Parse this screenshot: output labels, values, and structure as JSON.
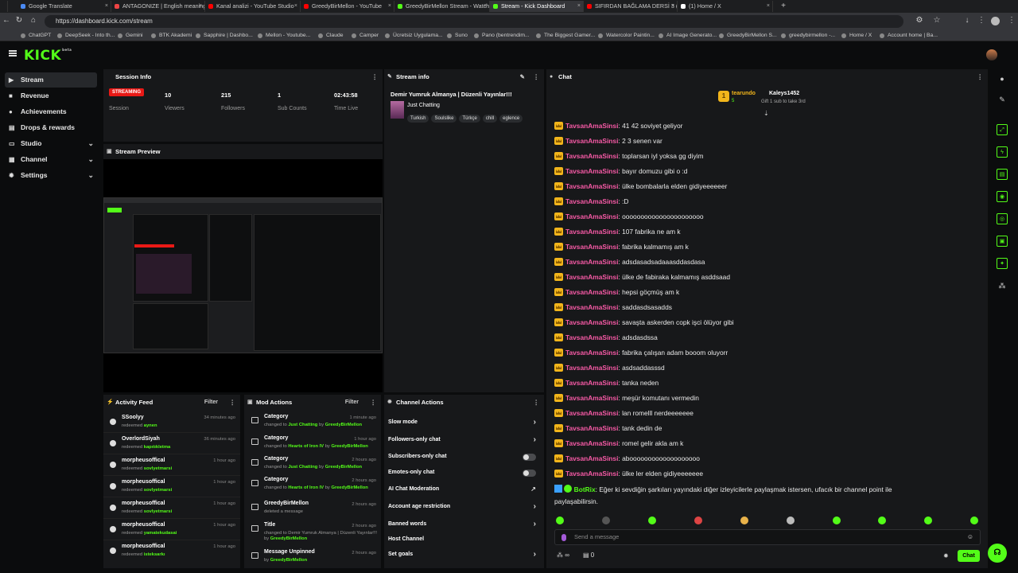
{
  "browser": {
    "tabs": [
      {
        "title": "Google Translate",
        "color": "#4a8af4"
      },
      {
        "title": "ANTAGONIZE | English meaning -",
        "color": "#e44"
      },
      {
        "title": "Kanal analizi - YouTube Studio",
        "color": "#f00"
      },
      {
        "title": "GreedyBirMellon - YouTube",
        "color": "#f00"
      },
      {
        "title": "GreedyBirMellon Stream - Watch L",
        "color": "#53fc18"
      },
      {
        "title": "Stream - Kick Dashboard",
        "color": "#53fc18"
      },
      {
        "title": "SIFIRDAN BAĞLAMA DERSİ 3 (EN",
        "color": "#f00"
      },
      {
        "title": "(1) Home / X",
        "color": "#fff"
      }
    ],
    "new_tab_label": "+",
    "url": "https://dashboard.kick.com/stream",
    "bookmarks": [
      "ChatGPT",
      "DeepSeek - Into th...",
      "Gemini",
      "BTK Akademi",
      "Sapphire | Dashbo...",
      "Mellon - Youtube...",
      "Claude",
      "Camper",
      "Ücretsiz Uygulama...",
      "Suno",
      "Pano (bentrendim...",
      "The Biggest Gamer...",
      "Watercolor Paintin...",
      "AI Image Generato...",
      "GreedyBirMellon S...",
      "greedybirmellon -...",
      "Home / X",
      "Account home | Ba..."
    ]
  },
  "header": {
    "logo": "KICK",
    "logo_sup": "beta"
  },
  "sidebar": {
    "items": [
      {
        "label": "Stream",
        "icon": "▶",
        "chev": ""
      },
      {
        "label": "Revenue",
        "icon": "■",
        "chev": ""
      },
      {
        "label": "Achievements",
        "icon": "●",
        "chev": ""
      },
      {
        "label": "Drops & rewards",
        "icon": "▤",
        "chev": ""
      },
      {
        "label": "Studio",
        "icon": "▭",
        "chev": "⌄"
      },
      {
        "label": "Channel",
        "icon": "▦",
        "chev": "⌄"
      },
      {
        "label": "Settings",
        "icon": "✹",
        "chev": "⌄"
      }
    ]
  },
  "session": {
    "title": "Session Info",
    "status": "STREAMING",
    "status_label": "Session",
    "stats": [
      {
        "value": "10",
        "label": "Viewers"
      },
      {
        "value": "215",
        "label": "Followers"
      },
      {
        "value": "1",
        "label": "Sub Counts"
      },
      {
        "value": "02:43:58",
        "label": "Time Live"
      }
    ]
  },
  "stream_info": {
    "title": "Stream info",
    "stream_title": "Demir Yumruk Almanya | Düzenli Yayınlar!!!",
    "category": "Just Chatting",
    "tags": [
      "Turkish",
      "Soulslike",
      "Türkçe",
      "chill",
      "eglence"
    ]
  },
  "preview": {
    "title": "Stream Preview"
  },
  "activity": {
    "title": "Activity Feed",
    "filter": "Filter",
    "items": [
      {
        "name": "SSoolyy",
        "action": "redeemed",
        "reward": "aynen",
        "time": "34 minutes ago"
      },
      {
        "name": "OverlordSiyah",
        "action": "redeemed",
        "reward": "kapıtıkletma",
        "time": "36 minutes ago"
      },
      {
        "name": "morpheusoffical",
        "action": "redeemed",
        "reward": "sovlyetmarsi",
        "time": "1 hour ago"
      },
      {
        "name": "morpheusoffical",
        "action": "redeemed",
        "reward": "sovlyetmarsi",
        "time": "1 hour ago"
      },
      {
        "name": "morpheusoffical",
        "action": "redeemed",
        "reward": "sovlyetmarsi",
        "time": "1 hour ago"
      },
      {
        "name": "morpheusoffical",
        "action": "redeemed",
        "reward": "yamatekudasai",
        "time": "1 hour ago"
      },
      {
        "name": "morpheusoffical",
        "action": "redeemed",
        "reward": "isteksarkı",
        "time": "1 hour ago"
      }
    ]
  },
  "mod": {
    "title": "Mod Actions",
    "filter": "Filter",
    "items": [
      {
        "name": "Category",
        "pre": "changed to ",
        "hl": "Just Chatting",
        "mid": " by ",
        "by": "GreedyBirMellon",
        "time": "1 minute ago"
      },
      {
        "name": "Category",
        "pre": "changed to ",
        "hl": "Hearts of Iron IV",
        "mid": " by ",
        "by": "GreedyBirMellon",
        "time": "1 hour ago"
      },
      {
        "name": "Category",
        "pre": "changed to ",
        "hl": "Just Chatting",
        "mid": " by ",
        "by": "GreedyBirMellon",
        "time": "2 hours ago"
      },
      {
        "name": "Category",
        "pre": "changed to ",
        "hl": "Hearts of Iron IV",
        "mid": " by ",
        "by": "GreedyBirMellon",
        "time": "2 hours ago"
      },
      {
        "name": "GreedyBirMellon",
        "pre": "deleted a message",
        "hl": "",
        "mid": "",
        "by": "",
        "time": "2 hours ago"
      },
      {
        "name": "Title",
        "pre": "changed to Demir Yumruk Almanya | Düzenli Yayınlar!!! by ",
        "hl": "",
        "mid": "",
        "by": "GreedyBirMellon",
        "time": "2 hours ago"
      },
      {
        "name": "Message Unpinned",
        "pre": "by ",
        "hl": "",
        "mid": "",
        "by": "GreedyBirMellon",
        "time": "2 hours ago"
      }
    ]
  },
  "channel_actions": {
    "title": "Channel Actions",
    "items": [
      {
        "label": "Slow mode",
        "ctrl": "arrow"
      },
      {
        "label": "Followers-only chat",
        "ctrl": "arrow"
      },
      {
        "label": "Subscribers-only chat",
        "ctrl": "toggle"
      },
      {
        "label": "Emotes-only chat",
        "ctrl": "toggle"
      },
      {
        "label": "AI Chat Moderation",
        "ctrl": "chart"
      },
      {
        "label": "Account age restriction",
        "ctrl": "arrow"
      },
      {
        "label": "Banned words",
        "ctrl": "arrow"
      },
      {
        "label": "Host Channel",
        "ctrl": "none"
      },
      {
        "label": "Set goals",
        "ctrl": "arrow"
      }
    ]
  },
  "chat": {
    "title": "Chat",
    "top_gifter": "tearundo",
    "top_gifter_count": "5",
    "top_rank": "1",
    "sub_user": "Kaleys1452",
    "sub_note": "Gift 1 sub to take 3rd",
    "messages": [
      {
        "user": "TavsanAmaSinsi",
        "text": "41 42 soviyet geliyor"
      },
      {
        "user": "TavsanAmaSinsi",
        "text": "2 3 senen var"
      },
      {
        "user": "TavsanAmaSinsi",
        "text": "toplarsan iyl yoksa gg diyim"
      },
      {
        "user": "TavsanAmaSinsi",
        "text": "bayır domuzu gibi o :d"
      },
      {
        "user": "TavsanAmaSinsi",
        "text": "ülke bombalarla elden gidiyeeeeeer"
      },
      {
        "user": "TavsanAmaSinsi",
        "text": ":D"
      },
      {
        "user": "TavsanAmaSinsi",
        "text": "oooooooooooooooooooooo"
      },
      {
        "user": "TavsanAmaSinsi",
        "text": "107 fabrika ne am k"
      },
      {
        "user": "TavsanAmaSinsi",
        "text": "fabrika kalmamış am k"
      },
      {
        "user": "TavsanAmaSinsi",
        "text": "adsdasadsadaaasddasdasa"
      },
      {
        "user": "TavsanAmaSinsi",
        "text": "ülke de fabiraka kalmamış asddsaad"
      },
      {
        "user": "TavsanAmaSinsi",
        "text": "hepsi göçmüş am k"
      },
      {
        "user": "TavsanAmaSinsi",
        "text": "saddasdsasadds"
      },
      {
        "user": "TavsanAmaSinsi",
        "text": "savaşta askerden copk işci ölüyor gibi"
      },
      {
        "user": "TavsanAmaSinsi",
        "text": "adsdasdssa"
      },
      {
        "user": "TavsanAmaSinsi",
        "text": "fabrika çalışan adam booom oluyorr"
      },
      {
        "user": "TavsanAmaSinsi",
        "text": "asdsaddasssd"
      },
      {
        "user": "TavsanAmaSinsi",
        "text": "tanka neden"
      },
      {
        "user": "TavsanAmaSinsi",
        "text": "meşür komutanı vermedin"
      },
      {
        "user": "TavsanAmaSinsi",
        "text": "lan romelll nerdeeeeeee"
      },
      {
        "user": "TavsanAmaSinsi",
        "text": "tank dedin de"
      },
      {
        "user": "TavsanAmaSinsi",
        "text": "romel gelir akla am k"
      },
      {
        "user": "TavsanAmaSinsi",
        "text": "abooooooooooooooooooo"
      },
      {
        "user": "TavsanAmaSinsi",
        "text": "ülke ler elden gidiyeeeeeee"
      }
    ],
    "bot_user": "BotRix",
    "bot_text": "Eğer ki sevdiğin şarkıları yayındaki diğer izleyicilerle paylaşmak istersen, ufacık bir channel point ile",
    "bot_text2": "paylaşabilirsin.",
    "placeholder": "Send a message",
    "infinite": "∞",
    "count": "0",
    "send_label": "Chat",
    "accent": "#53fc18",
    "user_color": "#f75aa6"
  }
}
